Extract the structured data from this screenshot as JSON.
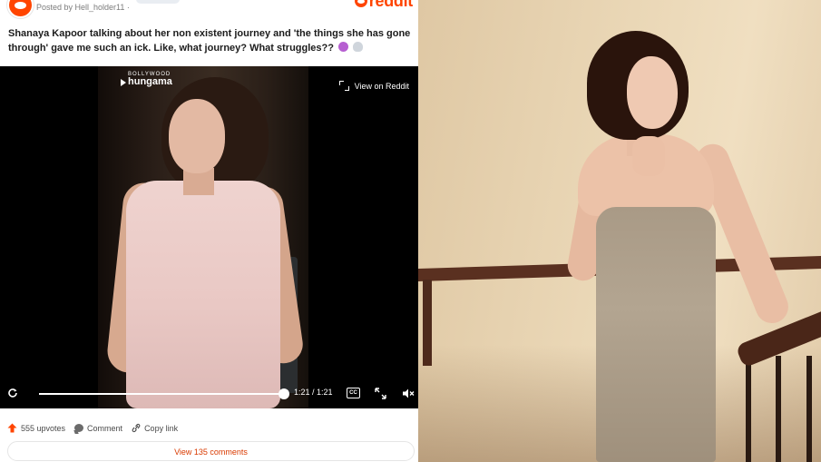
{
  "post": {
    "posted_by": "Posted by Hell_holder11 ·",
    "brand": "reddit",
    "title": "Shanaya Kapoor talking about her non existent journey and 'the things she has gone through' gave me such an ick. Like, what journey? What struggles??"
  },
  "video": {
    "watermark_small": "BOLLYWOOD",
    "watermark_big": "hungama",
    "view_on_reddit": "View on Reddit",
    "time": "1:21 / 1:21",
    "progress": 1.0,
    "cc_label": "CC"
  },
  "actions": {
    "upvotes": "555 upvotes",
    "comment": "Comment",
    "copy_link": "Copy link",
    "view_comments": "View 135 comments"
  },
  "colors": {
    "accent": "#ff4500",
    "comments_link": "#d93a00"
  }
}
